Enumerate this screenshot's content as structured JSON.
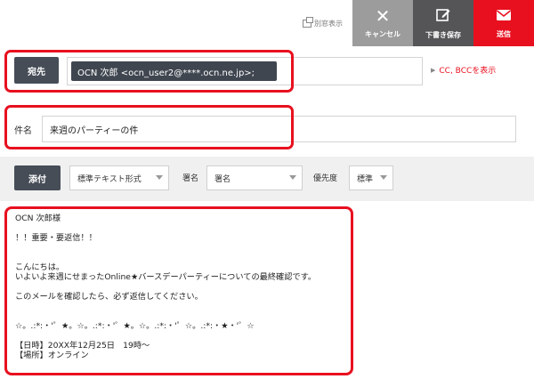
{
  "toolbar": {
    "popout_label": "別窓表示",
    "cancel_label": "キャンセル",
    "draft_label": "下書き保存",
    "send_label": "送信",
    "colors": {
      "cancel": "#9c9c9c",
      "draft": "#555558",
      "send": "#e8101f"
    }
  },
  "recipient": {
    "label": "宛先",
    "chip": "OCN 次郎 <ocn_user2@****.ocn.ne.jp>;",
    "cc_link": "CC, BCCを表示"
  },
  "subject": {
    "label": "件名",
    "value": "来週のパーティーの件"
  },
  "options": {
    "attach_label": "添付",
    "format_value": "標準テキスト形式",
    "signature_label": "署名",
    "signature_value": "署名",
    "priority_label": "優先度",
    "priority_value": "標準"
  },
  "body": {
    "text": "OCN 次郎様\n\n！！重要・要返信！！\n\n\nこんにちは。\nいよいよ来週にせまったOnline★バースデーパーティーについての最終確認です。\n\nこのメールを確認したら、必ず返信してください。\n\n\n☆。.:*:・'゜★。☆。.:*:・'゜★。☆。.:*:・'゜☆。.:*:・★・'゜☆\n\n【日時】20XX年12月25日　19時～\n【場所】オンライン"
  },
  "icons": {
    "cancel": "close-icon",
    "draft": "edit-icon",
    "send": "mail-icon",
    "popout": "popout-window-icon"
  }
}
